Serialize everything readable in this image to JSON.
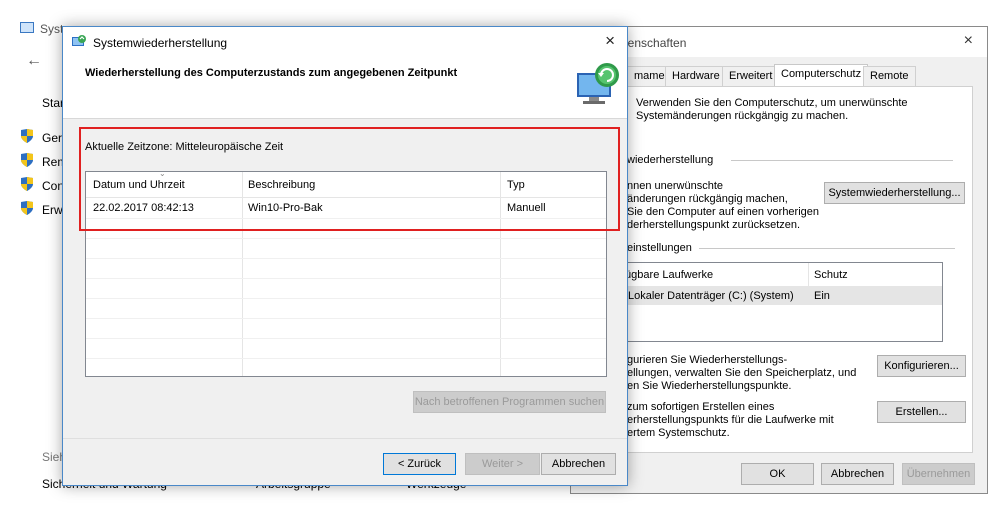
{
  "control_panel": {
    "title": "Syst",
    "start_label": "Star",
    "links": [
      "Gera",
      "Rem",
      "Con",
      "Erw"
    ],
    "bottom_heading": "Sieh",
    "bottom_items": [
      "Sicherheit und Wartung",
      "Arbeitsgruppe",
      "Werkzeuge"
    ]
  },
  "system_properties": {
    "title": "genschaften",
    "tabs": [
      "mame",
      "Hardware",
      "Erweitert",
      "Computerschutz",
      "Remote"
    ],
    "active_tab": "Computerschutz",
    "intro_line1": "Verwenden Sie den Computerschutz, um unerwünschte",
    "intro_line2": "Systemänderungen rückgängig zu machen.",
    "section_restore": "wiederherstellung",
    "restore_text_line1": "nnen unerwünschte",
    "restore_text_line2": "änderungen rückgängig machen,",
    "restore_text_line3": "Sie den Computer auf einen vorherigen",
    "restore_text_line4": "derherstellungspunkt zurücksetzen.",
    "restore_button": "Systemwiederherstellung...",
    "section_settings": "einstellungen",
    "drives_col_drive": "fügbare Laufwerke",
    "drives_col_protection": "Schutz",
    "drive_row_name": "Lokaler Datenträger (C:) (System)",
    "drive_row_protection": "Ein",
    "config_text_line1": "gurieren Sie Wiederherstellungs-",
    "config_text_line2": "ellungen, verwalten Sie den Speicherplatz, und",
    "config_text_line3": "en Sie Wiederherstellungspunkte.",
    "config_button": "Konfigurieren...",
    "create_text_line1": "zum sofortigen Erstellen eines",
    "create_text_line2": "erherstellungspunkts für die Laufwerke mit",
    "create_text_line3": "ertem Systemschutz.",
    "create_button": "Erstellen...",
    "ok_button": "OK",
    "cancel_button": "Abbrechen",
    "apply_button": "Übernehmen"
  },
  "dialog": {
    "title": "Systemwiederherstellung",
    "heading": "Wiederherstellung des Computerzustands zum angegebenen Zeitpunkt",
    "timezone": "Aktuelle Zeitzone: Mitteleuropäische Zeit",
    "columns": [
      "Datum und Uhrzeit",
      "Beschreibung",
      "Typ"
    ],
    "rows": [
      {
        "date": "22.02.2017 08:42:13",
        "description": "Win10-Pro-Bak",
        "type": "Manuell"
      }
    ],
    "scan_button": "Nach betroffenen Programmen suchen",
    "back_button": "< Zurück",
    "next_button": "Weiter >",
    "cancel_button": "Abbrechen"
  },
  "icons": {
    "close": "×",
    "back_arrow": "←",
    "sort": "⌄"
  },
  "colors": {
    "highlight_border": "#e02020",
    "dialog_accent": "#4a88c8"
  }
}
